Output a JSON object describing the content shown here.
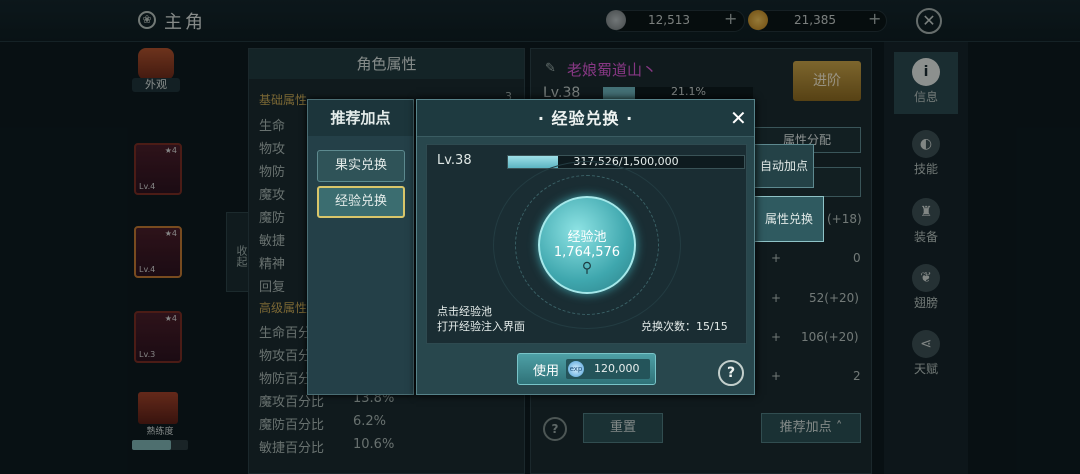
{
  "topbar": {
    "title": "主角",
    "currency1": {
      "value": "12,513",
      "color": "#8a9395"
    },
    "currency2": {
      "value": "21,385",
      "color": "#d4a23a"
    },
    "plus": "+",
    "close": "✕"
  },
  "left": {
    "appearance_label": "外观",
    "slots": [
      {
        "lv": "Lv.4",
        "star": "★4"
      },
      {
        "lv": "Lv.4",
        "star": "★4"
      },
      {
        "lv": "Lv.3",
        "star": "★4"
      }
    ],
    "proficiency_label": "熟练度",
    "collapse_label": "收起"
  },
  "attr_panel": {
    "title": "角色属性",
    "base_header": "基础属性",
    "rows": [
      "生命",
      "物攻",
      "物防",
      "魔攻",
      "魔防",
      "敏捷",
      "精神",
      "回复"
    ],
    "adv_header": "高级属性",
    "adv_rows": [
      {
        "name": "生命百分比",
        "value": ""
      },
      {
        "name": "物攻百分比",
        "value": ""
      },
      {
        "name": "物防百分比",
        "value": ""
      },
      {
        "name": "魔攻百分比",
        "value": "13.8%"
      },
      {
        "name": "魔防百分比",
        "value": "6.2%"
      },
      {
        "name": "敏捷百分比",
        "value": "10.6%"
      }
    ],
    "count": "3"
  },
  "char_panel": {
    "name": "老娘蜀道山丶",
    "level": "Lv.38",
    "exp_pct": "21.1%",
    "advance_btn": "进阶",
    "attr_alloc_tab": "属性分配",
    "auto_add": "自动加点",
    "attr_exchange": "属性兑换",
    "values": [
      "(+18)",
      "0",
      "52(+20)",
      "106(+20)",
      "2"
    ],
    "reset_btn": "重置",
    "recommend_btn": "推荐加点"
  },
  "right_nav": [
    {
      "label": "信息",
      "icon": "info-icon"
    },
    {
      "label": "技能",
      "icon": "skill-icon"
    },
    {
      "label": "装备",
      "icon": "armor-icon"
    },
    {
      "label": "翅膀",
      "icon": "wings-icon"
    },
    {
      "label": "天赋",
      "icon": "talent-icon"
    }
  ],
  "recommend": {
    "title": "推荐加点",
    "btn_fruit": "果实兑换",
    "btn_exp": "经验兑换"
  },
  "modal": {
    "title": "· 经验兑换 ·",
    "level": "Lv.38",
    "exp_text": "317,526/1,500,000",
    "exp_fraction": 0.2117,
    "pool_label": "经验池",
    "pool_value": "1,764,576",
    "hint_line1": "点击经验池",
    "hint_line2": "打开经验注入界面",
    "exchange_count": "兑换次数：15/15",
    "use_label": "使用",
    "cost": "120,000",
    "help": "?"
  }
}
